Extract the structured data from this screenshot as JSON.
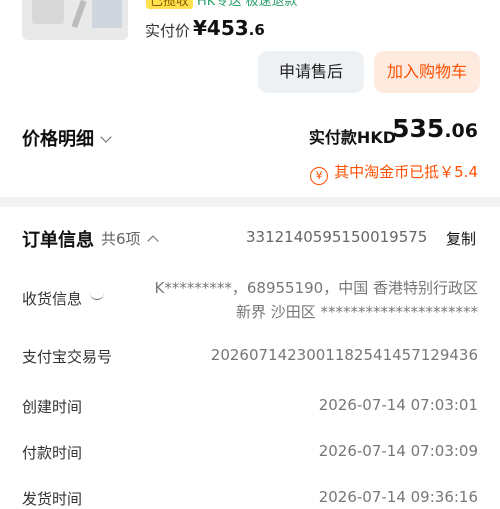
{
  "product": {
    "tag": "已揽收",
    "service": "HK专送 极速退款",
    "paid_label": "实付价",
    "paid_currency": "¥",
    "paid_int": "453",
    "paid_dec": ".6"
  },
  "actions": {
    "after_sale": "申请售后",
    "add_cart": "加入购物车"
  },
  "price": {
    "title": "价格明细",
    "actual_label": "实付款HKD",
    "actual_int": "535",
    "actual_dec": ".06",
    "coin_icon": "¥",
    "coin_text": "其中淘金币已抵￥5.4"
  },
  "order": {
    "title": "订单信息",
    "count": "共6项",
    "number": "3312140595150019575",
    "copy": "复制",
    "rows": {
      "receiver": {
        "label": "收货信息",
        "value": "K*********，68955190，中国 香港特别行政区 新界 沙田区 *********************"
      },
      "alipay": {
        "label": "支付宝交易号",
        "value": "2026071423001182541457129436"
      },
      "created": {
        "label": "创建时间",
        "value": "2026-07-14 07:03:01"
      },
      "paid": {
        "label": "付款时间",
        "value": "2026-07-14 07:03:09"
      },
      "shipped": {
        "label": "发货时间",
        "value": "2026-07-14 09:36:16"
      }
    }
  },
  "colors": {
    "accent": "#ff5000",
    "button_grey": "#eef1f4",
    "button_orange_bg": "#ffeadf"
  }
}
